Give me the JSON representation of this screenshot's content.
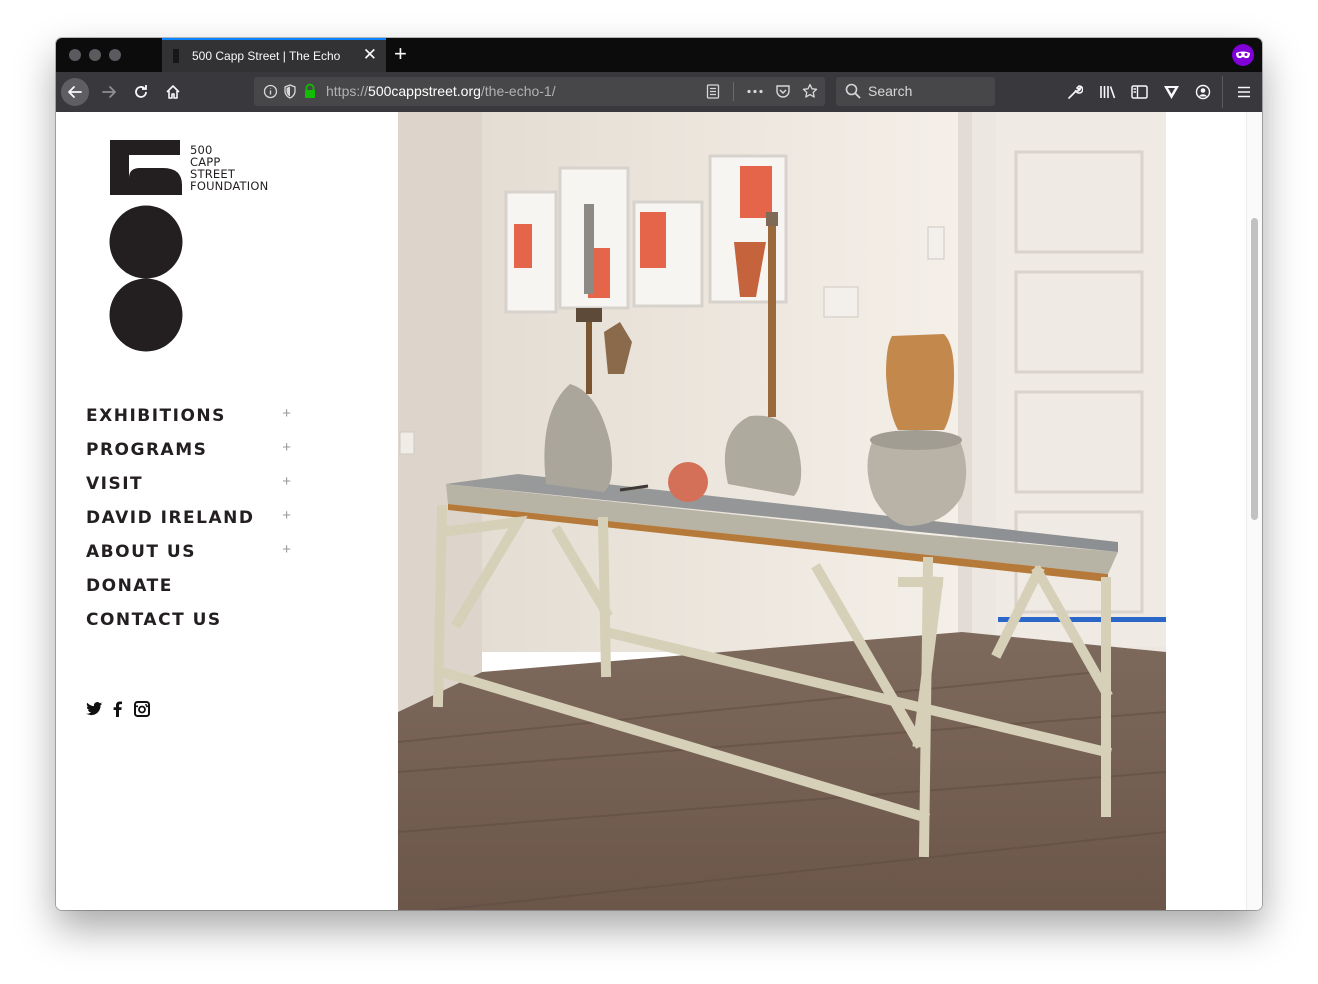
{
  "browser": {
    "tab_title": "500 Capp Street | The Echo",
    "close_glyph": "✕",
    "newtab_glyph": "+",
    "url_scheme": "https://",
    "url_host": "500cappstreet.org",
    "url_path": "/the-echo-1/",
    "search_placeholder": "Search",
    "icons": [
      "back-icon",
      "forward-icon",
      "reload-icon",
      "home-icon",
      "info-icon",
      "tracking-shield-icon",
      "lock-icon",
      "reader-view-icon",
      "page-actions-icon",
      "pocket-icon",
      "bookmark-star-icon",
      "search-icon",
      "tools-icon",
      "library-icon",
      "sidebar-icon",
      "extension-icon",
      "account-icon",
      "menu-icon",
      "private-browsing-icon"
    ],
    "colors": {
      "accent": "#0a84ff",
      "private": "#8000d7",
      "lock": "#12bc00"
    }
  },
  "site": {
    "logo": {
      "number": "500",
      "tagline": [
        "500",
        "CAPP",
        "STREET",
        "FOUNDATION"
      ]
    },
    "nav": [
      {
        "label": "EXHIBITIONS",
        "expand": "+"
      },
      {
        "label": "PROGRAMS",
        "expand": "+"
      },
      {
        "label": "VISIT",
        "expand": "+"
      },
      {
        "label": "DAVID IRELAND",
        "expand": "+"
      },
      {
        "label": "ABOUT US",
        "expand": "+"
      },
      {
        "label": "DONATE",
        "expand": ""
      },
      {
        "label": "CONTACT US",
        "expand": ""
      }
    ],
    "social": [
      "twitter-icon",
      "facebook-icon",
      "instagram-icon"
    ],
    "photo_subject": "gallery-installation-photo"
  }
}
